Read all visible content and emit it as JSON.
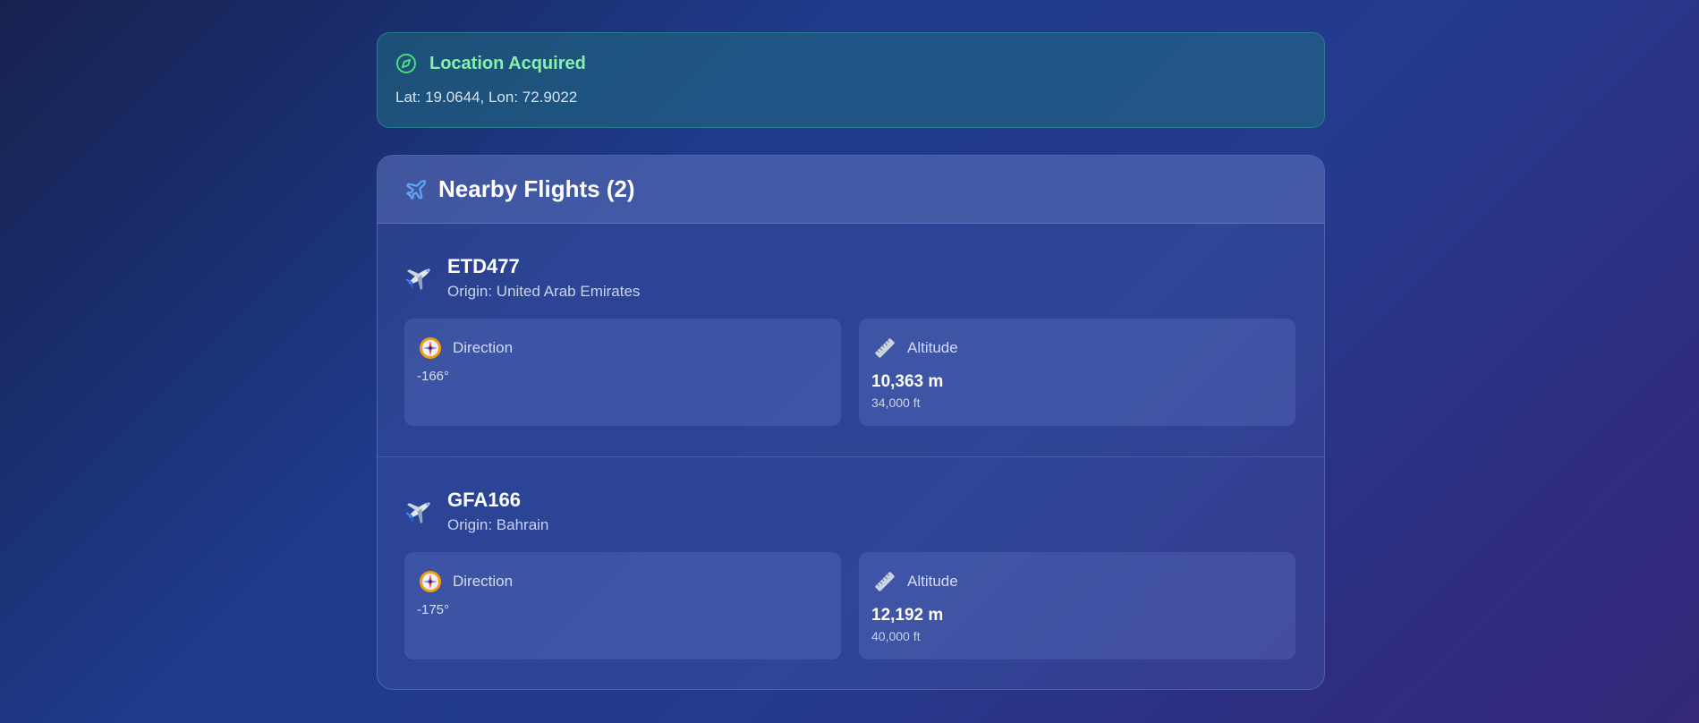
{
  "location": {
    "title": "Location Acquired",
    "coords": "Lat: 19.0644, Lon: 72.9022",
    "icon": "compass-icon",
    "accent_color": "#86efac"
  },
  "flights_panel": {
    "title": "Nearby Flights (2)",
    "icon": "airplane-icon",
    "flights": [
      {
        "callsign": "ETD477",
        "origin": "Origin: United Arab Emirates",
        "direction_label": "Direction",
        "direction_value": "-166°",
        "altitude_label": "Altitude",
        "altitude_m": "10,363 m",
        "altitude_ft": "34,000 ft"
      },
      {
        "callsign": "GFA166",
        "origin": "Origin: Bahrain",
        "direction_label": "Direction",
        "direction_value": "-175°",
        "altitude_label": "Altitude",
        "altitude_m": "12,192 m",
        "altitude_ft": "40,000 ft"
      }
    ]
  }
}
